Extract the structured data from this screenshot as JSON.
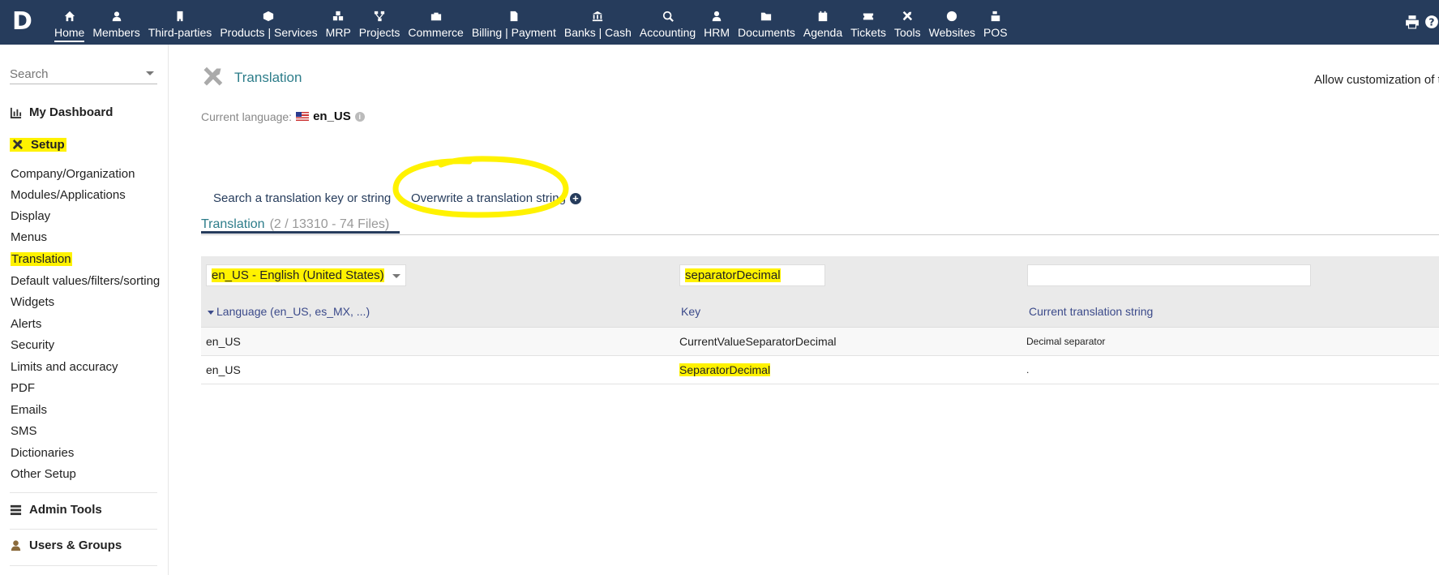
{
  "topbar": {
    "logo": "D",
    "menu": [
      {
        "label": "Home",
        "icon": "home-icon",
        "active": true
      },
      {
        "label": "Members",
        "icon": "member-icon"
      },
      {
        "label": "Third-parties",
        "icon": "building-icon"
      },
      {
        "label": "Products | Services",
        "icon": "cube-icon"
      },
      {
        "label": "MRP",
        "icon": "cubes-icon"
      },
      {
        "label": "Projects",
        "icon": "project-icon"
      },
      {
        "label": "Commerce",
        "icon": "briefcase-icon"
      },
      {
        "label": "Billing | Payment",
        "icon": "invoice-icon"
      },
      {
        "label": "Banks | Cash",
        "icon": "bank-icon"
      },
      {
        "label": "Accounting",
        "icon": "search-dollar-icon"
      },
      {
        "label": "HRM",
        "icon": "user-tie-icon"
      },
      {
        "label": "Documents",
        "icon": "folder-icon"
      },
      {
        "label": "Agenda",
        "icon": "calendar-icon"
      },
      {
        "label": "Tickets",
        "icon": "ticket-icon"
      },
      {
        "label": "Tools",
        "icon": "tools-icon"
      },
      {
        "label": "Websites",
        "icon": "globe-icon"
      },
      {
        "label": "POS",
        "icon": "cash-register-icon"
      }
    ]
  },
  "sidebar": {
    "search_placeholder": "Search",
    "dashboard": "My Dashboard",
    "setup": "Setup",
    "links": [
      "Company/Organization",
      "Modules/Applications",
      "Display",
      "Menus",
      "Translation",
      "Default values/filters/sorting",
      "Widgets",
      "Alerts",
      "Security",
      "Limits and accuracy",
      "PDF",
      "Emails",
      "SMS",
      "Dictionaries",
      "Other Setup"
    ],
    "admin_tools": "Admin Tools",
    "users_groups": "Users & Groups"
  },
  "main": {
    "title": "Translation",
    "top_note": "Allow customization of t",
    "current_language_label": "Current language:",
    "current_language": "en_US",
    "tabs": [
      "Search a translation key or string",
      "Overwrite a translation string"
    ],
    "section_title": "Translation",
    "section_count": "(2 / 13310 - 74 Files)",
    "filter": {
      "language_select": "en_US - English (United States)",
      "key_value": "separatorDecimal",
      "translation_value": ""
    },
    "columns": [
      "Language (en_US, es_MX, ...)",
      "Key",
      "Current translation string"
    ],
    "rows": [
      {
        "lang": "en_US",
        "key": "CurrentValueSeparatorDecimal",
        "value": "Decimal separator"
      },
      {
        "lang": "en_US",
        "key": "SeparatorDecimal",
        "value": "."
      }
    ]
  },
  "colors": {
    "topbar": "#263c5c",
    "link": "#2d7d8a",
    "highlight": "#fff200"
  }
}
